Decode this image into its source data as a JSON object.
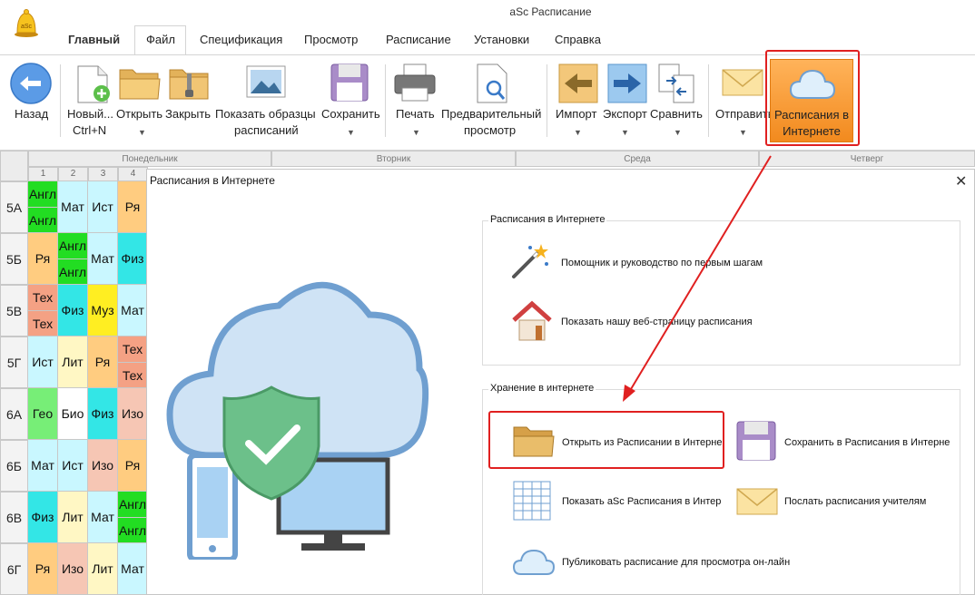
{
  "window": {
    "title": "aSc Расписание"
  },
  "tabs": [
    "Главный",
    "Файл",
    "Спецификация",
    "Просмотр",
    "Расписание",
    "Установки",
    "Справка"
  ],
  "ribbon": {
    "back": "Назад",
    "new_line1": "Новый...",
    "new_line2": "Ctrl+N",
    "open": "Открыть",
    "close": "Закрыть",
    "samples_line1": "Показать образцы",
    "samples_line2": "расписаний",
    "save": "Сохранить",
    "print": "Печать",
    "preview_line1": "Предварительный",
    "preview_line2": "просмотр",
    "import": "Импорт",
    "export": "Экспорт",
    "compare": "Сравнить",
    "send": "Отправить",
    "online_line1": "Расписания в",
    "online_line2": "Интернете"
  },
  "grid": {
    "days": [
      "Понедельник",
      "Вторник",
      "Среда",
      "Четверг"
    ],
    "periods": [
      "1",
      "2",
      "3",
      "4"
    ],
    "rows": [
      {
        "class": "5А",
        "cells": [
          [
            "Англ",
            "Англ"
          ],
          [
            "Мат"
          ],
          [
            "Ист"
          ],
          [
            "Ря"
          ]
        ]
      },
      {
        "class": "5Б",
        "cells": [
          [
            "Ря"
          ],
          [
            "Англ",
            "Англ"
          ],
          [
            "Мат"
          ],
          [
            "Физ"
          ]
        ]
      },
      {
        "class": "5В",
        "cells": [
          [
            "Тех",
            "Тех"
          ],
          [
            "Физ"
          ],
          [
            "Муз"
          ],
          [
            "Мат"
          ]
        ]
      },
      {
        "class": "5Г",
        "cells": [
          [
            "Ист"
          ],
          [
            "Лит"
          ],
          [
            "Ря"
          ],
          [
            "Тех",
            "Тех"
          ]
        ]
      },
      {
        "class": "6А",
        "cells": [
          [
            "Гео"
          ],
          [
            "Био"
          ],
          [
            "Физ"
          ],
          [
            "Изо"
          ]
        ]
      },
      {
        "class": "6Б",
        "cells": [
          [
            "Мат"
          ],
          [
            "Ист"
          ],
          [
            "Изо"
          ],
          [
            "Ря"
          ]
        ]
      },
      {
        "class": "6В",
        "cells": [
          [
            "Физ"
          ],
          [
            "Лит"
          ],
          [
            "Мат"
          ],
          [
            "Англ",
            "Англ"
          ]
        ]
      },
      {
        "class": "6Г",
        "cells": [
          [
            "Ря"
          ],
          [
            "Изо"
          ],
          [
            "Лит"
          ],
          [
            "Мат"
          ]
        ]
      }
    ]
  },
  "colors": {
    "Англ": "#22dd22",
    "Мат": "#c9f7ff",
    "Ист": "#c9f7ff",
    "Ря": "#ffcc80",
    "Физ": "#33e6e6",
    "Тех": "#f4a184",
    "Муз": "#ffee22",
    "Лит": "#fff7c4",
    "Гео": "#77ee77",
    "Био": "#ffffff",
    "Изо": "#f6c6b4",
    "accent": "#f7941d",
    "highlight": "#e02020"
  },
  "dialog": {
    "title": "Расписания в Интернете",
    "group1_title": "Расписания в Интернете",
    "wizard": "Помощник и руководство по первым шагам",
    "webpage": "Показать нашу веб-страницу расписания",
    "group2_title": "Хранение в интернете",
    "open_online": "Открыть из Расписании в Интерне",
    "save_online": "Сохранить в Расписания в Интерне",
    "show_online": "Показать aSc Расписания в Интер",
    "send_teachers": "Послать расписания учителям",
    "publish": "Публиковать расписание для просмотра он-лайн"
  },
  "icons": [
    "app-bell-icon",
    "back-arrow-icon",
    "new-file-icon",
    "folder-icon",
    "zip-close-icon",
    "image-samples-icon",
    "floppy-save-icon",
    "printer-icon",
    "preview-magnifier-icon",
    "import-arrow-icon",
    "export-arrow-icon",
    "compare-docs-icon",
    "envelope-icon",
    "cloud-icon",
    "magic-wand-icon",
    "house-icon",
    "grid-table-icon",
    "shield-check-icon"
  ]
}
